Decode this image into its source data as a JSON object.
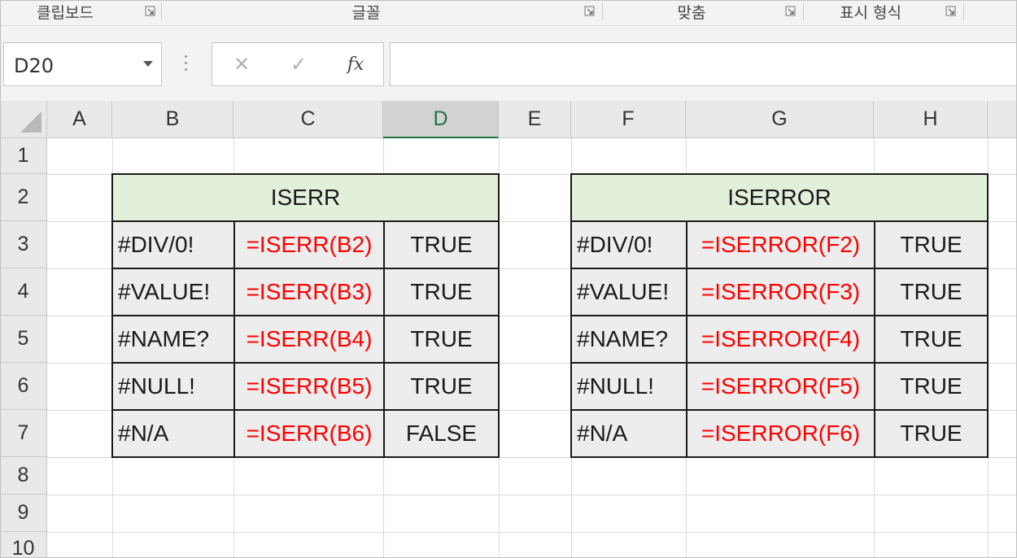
{
  "ribbon": {
    "groups": [
      "클립보드",
      "글꼴",
      "맞춤",
      "표시 형식"
    ]
  },
  "formula_bar": {
    "name_box": "D20",
    "cancel_icon": "✕",
    "enter_icon": "✓",
    "fx_label": "fx",
    "formula": ""
  },
  "sheet": {
    "columns": [
      "A",
      "B",
      "C",
      "D",
      "E",
      "F",
      "G",
      "H"
    ],
    "selected_column": "D",
    "rows": [
      "1",
      "2",
      "3",
      "4",
      "5",
      "6",
      "7",
      "8",
      "9",
      "10"
    ]
  },
  "iserr_table": {
    "title": "ISERR",
    "rows": [
      {
        "value": "#DIV/0!",
        "formula": "=ISERR(B2)",
        "result": "TRUE"
      },
      {
        "value": "#VALUE!",
        "formula": "=ISERR(B3)",
        "result": "TRUE"
      },
      {
        "value": "#NAME?",
        "formula": "=ISERR(B4)",
        "result": "TRUE"
      },
      {
        "value": "#NULL!",
        "formula": "=ISERR(B5)",
        "result": "TRUE"
      },
      {
        "value": "#N/A",
        "formula": "=ISERR(B6)",
        "result": "FALSE"
      }
    ]
  },
  "iserror_table": {
    "title": "ISERROR",
    "rows": [
      {
        "value": "#DIV/0!",
        "formula": "=ISERROR(F2)",
        "result": "TRUE"
      },
      {
        "value": "#VALUE!",
        "formula": "=ISERROR(F3)",
        "result": "TRUE"
      },
      {
        "value": "#NAME?",
        "formula": "=ISERROR(F4)",
        "result": "TRUE"
      },
      {
        "value": "#NULL!",
        "formula": "=ISERROR(F5)",
        "result": "TRUE"
      },
      {
        "value": "#N/A",
        "formula": "=ISERROR(F6)",
        "result": "TRUE"
      }
    ]
  },
  "colors": {
    "header_fill": "#e2efda",
    "cell_fill": "#ededed",
    "formula_text": "#ff0000",
    "selection_accent": "#217346"
  }
}
